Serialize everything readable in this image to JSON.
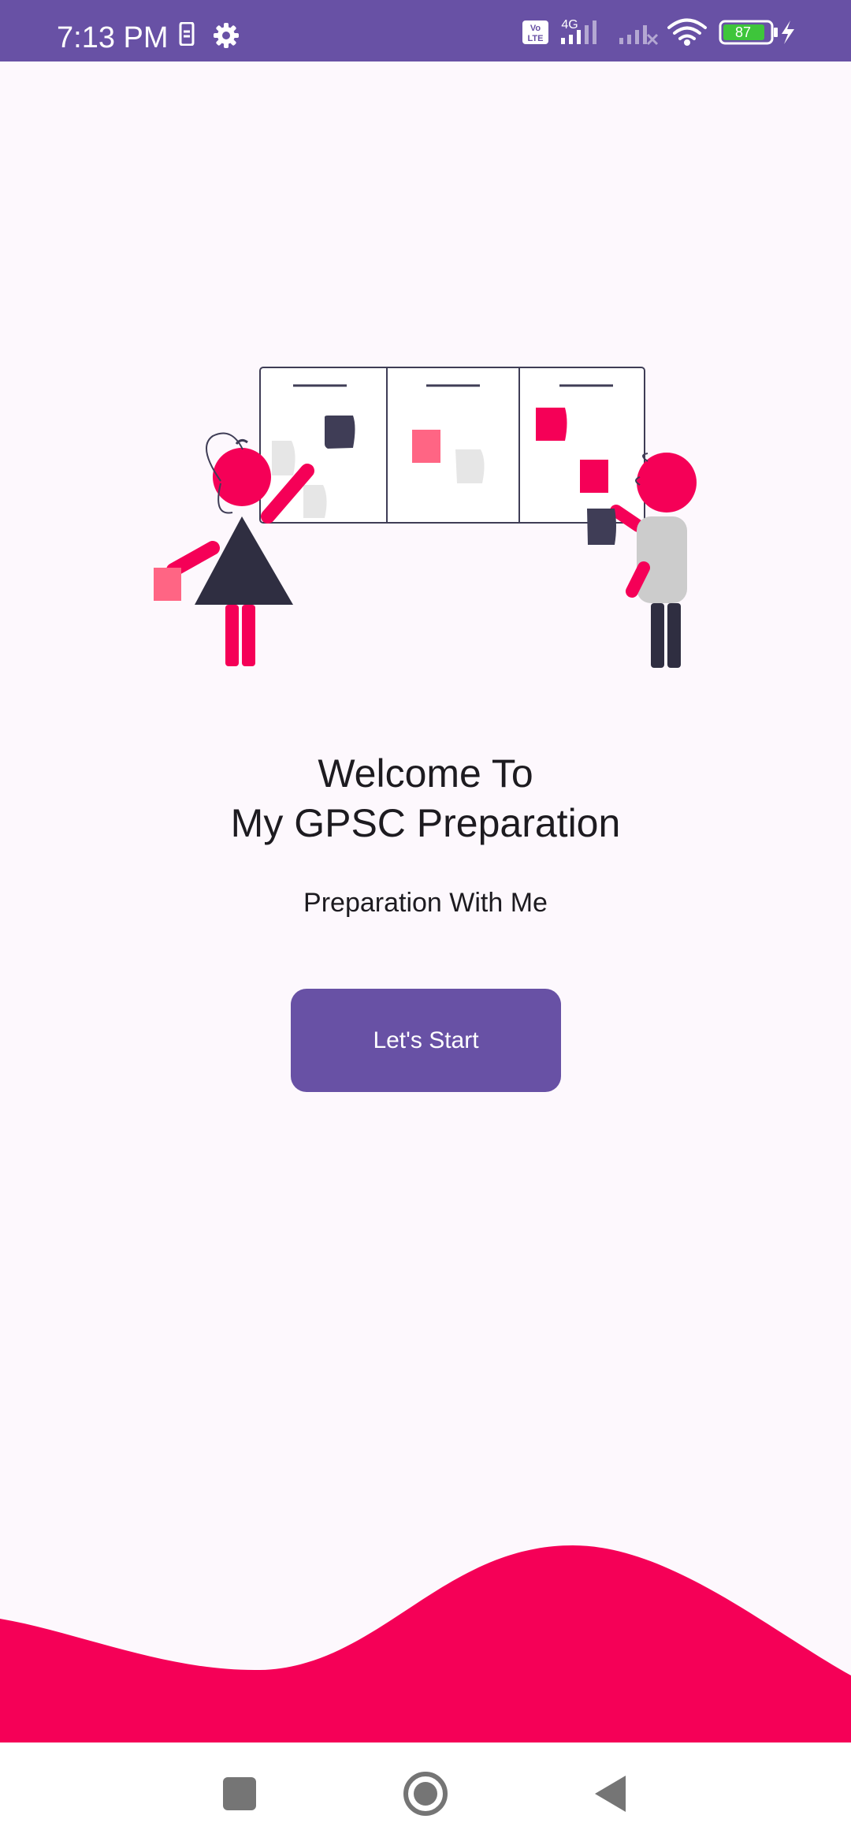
{
  "status_bar": {
    "time": "7:13 PM",
    "network_label": "4G",
    "volte_label": "Vo LTE",
    "battery_level": "87",
    "icons": [
      "sim-card-icon",
      "settings-gear-icon",
      "volte-icon",
      "signal-icon",
      "signal-no-service-icon",
      "wifi-icon",
      "battery-icon",
      "charging-bolt-icon"
    ]
  },
  "welcome": {
    "line1": "Welcome To",
    "line2": "My GPSC Preparation",
    "subtitle": "Preparation With Me"
  },
  "actions": {
    "start_label": "Let's Start"
  },
  "nav_bar": {
    "icons": [
      "recents-square-icon",
      "home-circle-icon",
      "back-triangle-icon"
    ]
  },
  "colors": {
    "primary": "#6851a5",
    "accent": "#f50057",
    "background": "#fdf8fd",
    "text": "#1d1b20"
  }
}
